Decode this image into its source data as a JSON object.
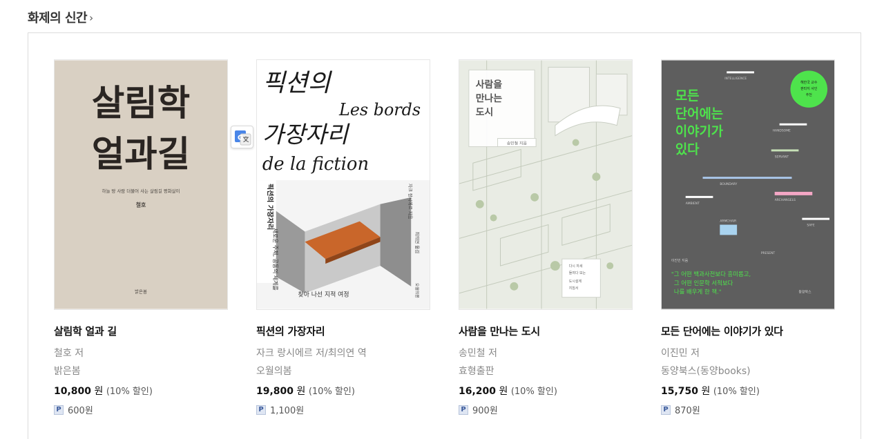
{
  "section": {
    "title": "화제의 신간",
    "chevron": "›"
  },
  "books": [
    {
      "title": "살림학 얼과 길",
      "author": "철호 저",
      "publisher": "밝은봄",
      "price": "10,800",
      "currency": "원",
      "discount": "(10% 할인)",
      "point_badge": "P",
      "points": "600원",
      "cover": {
        "bg": "#ddd5c8",
        "title_line1": "살림학",
        "title_line2": "얼과길",
        "subtitle": "하늘 땅 사람 더불어 사는 살림길 평화살이",
        "author_mark": "철호",
        "publisher_mark": "밝은봄"
      }
    },
    {
      "title": "픽션의 가장자리",
      "author": "자크 랑시에르 저/최의연 역",
      "publisher": "오월의봄",
      "price": "19,800",
      "currency": "원",
      "discount": "(10% 할인)",
      "point_badge": "P",
      "points": "1,100원",
      "cover": {
        "bg": "#ffffff",
        "title_ko_1": "픽션의",
        "title_ko_2": "가장자리",
        "title_fr_1": "Les bords",
        "title_fr_2": "de la fiction",
        "spine_title": "픽션의 가장자리",
        "spine_sub": "새로운 주체, 공동의 세계를",
        "bottom_text": "찾아 나선 지적 여정",
        "right_text_1": "자크 랑시에르 지음",
        "right_text_2": "최의연 옮김",
        "publisher_mark": "오월의봄"
      }
    },
    {
      "title": "사람을 만나는 도시",
      "author": "송민철 저",
      "publisher": "효형출판",
      "price": "16,200",
      "currency": "원",
      "discount": "(10% 할인)",
      "point_badge": "P",
      "points": "900원",
      "cover": {
        "bg": "#e9ece4",
        "title_1": "사람을",
        "title_2": "만나는",
        "title_3": "도시",
        "author_mark": "송민철 지음",
        "tagline_1": "다시 자세",
        "tagline_2": "들여다 보는",
        "tagline_3": "도시설계",
        "tagline_4": "지침서"
      }
    },
    {
      "title": "모든 단어에는 이야기가 있다",
      "author": "이진민 저",
      "publisher": "동양북스(동양books)",
      "price": "15,750",
      "currency": "원",
      "discount": "(10% 할인)",
      "point_badge": "P",
      "points": "870원",
      "cover": {
        "bg": "#5e5e5e",
        "accent": "#4ee34c",
        "title_1": "모든",
        "title_2": "단어에는",
        "title_3": "이야기가",
        "title_4": "있다",
        "badge_1": "해한국 교수",
        "badge_2": "판타지 사인",
        "badge_3": "추천",
        "words": [
          "INTELLIGENCE",
          "HANDSOME",
          "SERVANT",
          "BOUNDARY",
          "ARCHANGELS",
          "AMBIENT",
          "ARMCHAIR",
          "SAFE",
          "PRESENT"
        ],
        "author_mark": "이진민 지음",
        "quote_1": "\"그 어떤 백과사전보다 흥미롭고,",
        "quote_2": "그 어떤 인문학 서적보다",
        "quote_3": "나를 배우게 한 책.\"",
        "publisher_mark": "동양북스"
      }
    }
  ],
  "translate_button": {
    "icon": "google-translate-icon",
    "glyph": "G"
  }
}
